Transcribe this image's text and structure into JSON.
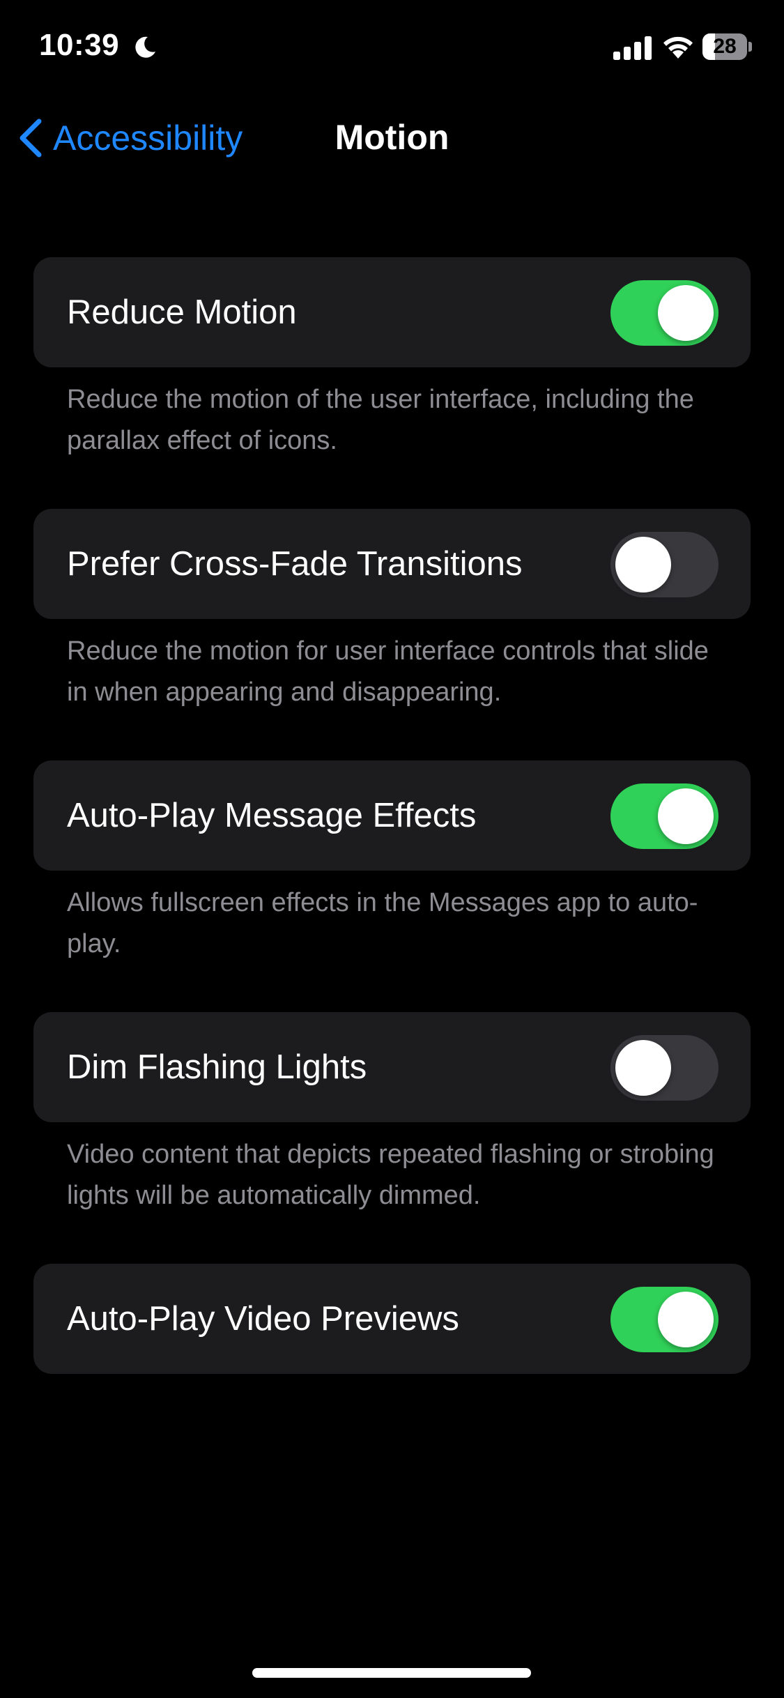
{
  "status_bar": {
    "time": "10:39",
    "focus_icon": "moon-icon",
    "signal_icon": "cellular-signal-icon",
    "wifi_icon": "wifi-icon",
    "battery_level": "28",
    "battery_fraction": 0.28
  },
  "nav": {
    "back_label": "Accessibility",
    "back_icon": "chevron-left-icon",
    "title": "Motion"
  },
  "colors": {
    "accent": "#1f87ff",
    "toggle_on": "#30d158",
    "toggle_off": "#39393d",
    "cell_background": "#1c1c1e",
    "footer_text": "#8d8d93"
  },
  "settings": [
    {
      "label": "Reduce Motion",
      "enabled": true,
      "footer": "Reduce the motion of the user interface, including the parallax effect of icons."
    },
    {
      "label": "Prefer Cross-Fade Transitions",
      "enabled": false,
      "footer": "Reduce the motion for user interface controls that slide in when appearing and disappearing."
    },
    {
      "label": "Auto-Play Message Effects",
      "enabled": true,
      "footer": "Allows fullscreen effects in the Messages app to auto-play."
    },
    {
      "label": "Dim Flashing Lights",
      "enabled": false,
      "footer": "Video content that depicts repeated flashing or strobing lights will be automatically dimmed."
    },
    {
      "label": "Auto-Play Video Previews",
      "enabled": true,
      "footer": ""
    }
  ]
}
